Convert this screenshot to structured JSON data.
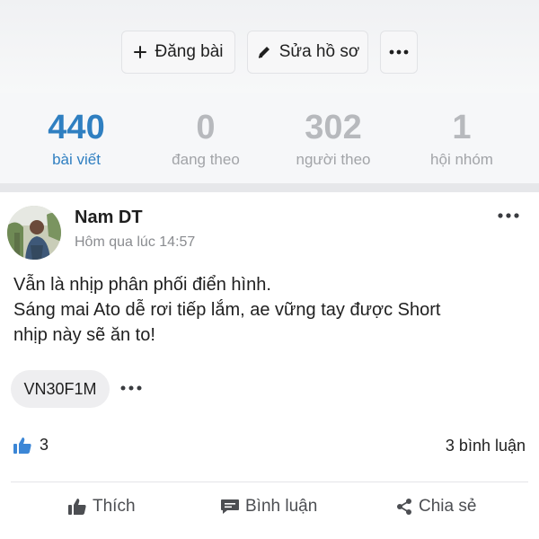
{
  "profile_actions": {
    "post_label": "Đăng bài",
    "edit_profile_label": "Sửa hồ sơ"
  },
  "stats": [
    {
      "value": "440",
      "label": "bài viết"
    },
    {
      "value": "0",
      "label": "đang theo"
    },
    {
      "value": "302",
      "label": "người theo"
    },
    {
      "value": "1",
      "label": "hội nhóm"
    }
  ],
  "post": {
    "author": "Nam DT",
    "time": "Hôm qua lúc 14:57",
    "content_lines": [
      "Vẫn là nhịp phân phối điển hình.",
      "Sáng mai Ato dễ rơi tiếp lắm, ae vững tay được Short",
      "nhịp này sẽ ăn to!"
    ],
    "tag": "VN30F1M",
    "like_count": "3",
    "comment_count": "3 bình luận"
  },
  "post_actions": {
    "like_label": "Thích",
    "comment_label": "Bình luận",
    "share_label": "Chia sẻ"
  },
  "colors": {
    "accent": "#2f7fc1",
    "like_icon": "#3b86d6"
  },
  "icons": {
    "add": "plus-icon",
    "edit": "pencil-icon",
    "more": "more-horizontal-icon",
    "like": "thumbs-up-icon",
    "comment": "comment-icon",
    "share": "share-icon"
  }
}
